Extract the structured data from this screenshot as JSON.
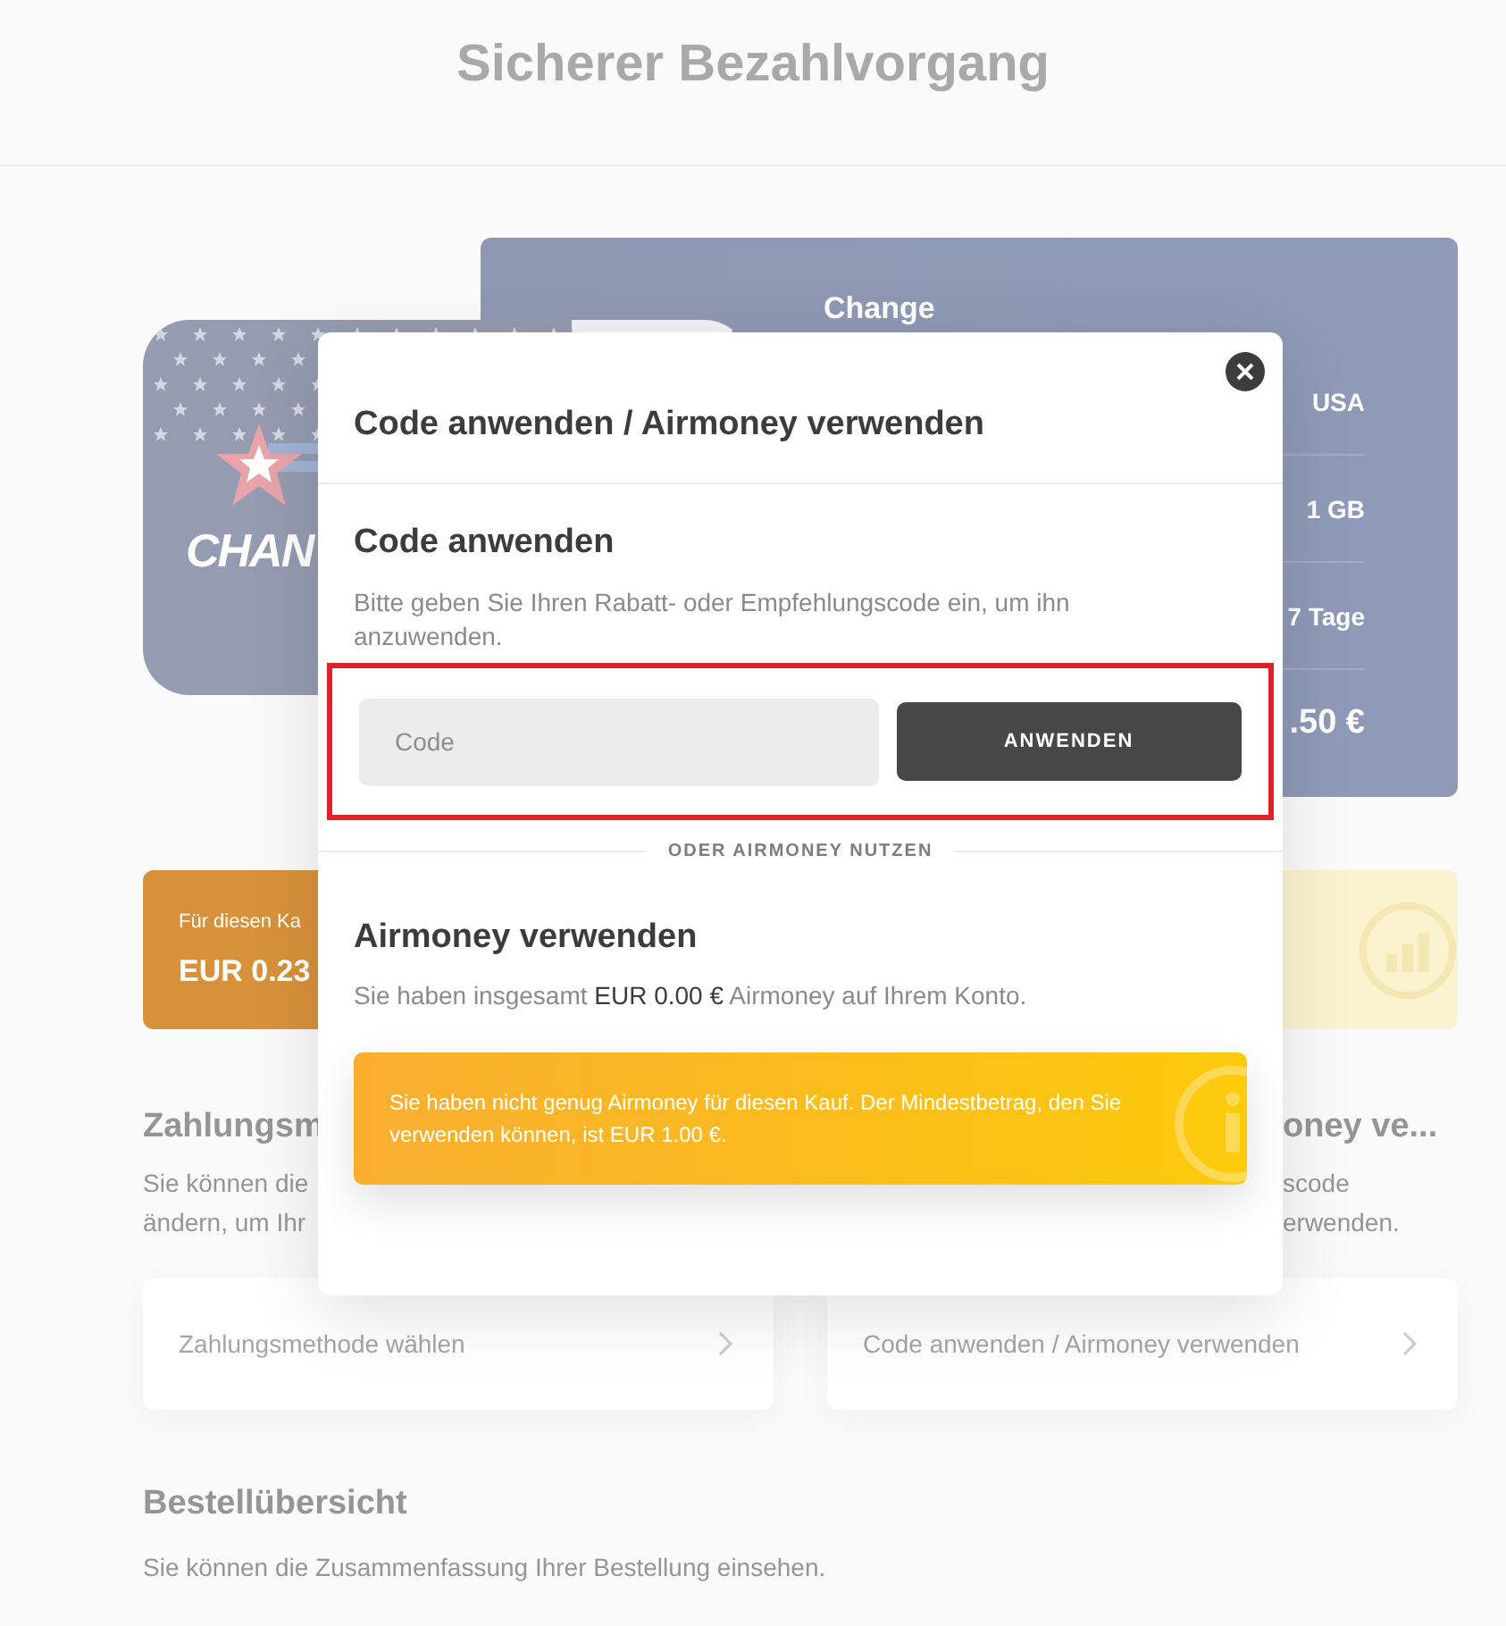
{
  "page": {
    "title": "Sicherer Bezahlvorgang"
  },
  "product": {
    "card_brand": "CHAN",
    "name": "Change",
    "details": [
      {
        "value": "USA"
      },
      {
        "value": "1 GB"
      },
      {
        "value": "7 Tage"
      }
    ],
    "price": ".50 €"
  },
  "cashback": {
    "label": "Für diesen Ka",
    "amount": "EUR 0.23"
  },
  "payment_section": {
    "title": "Zahlungsm",
    "lines": [
      "Sie können die",
      "ändern, um Ihr"
    ]
  },
  "code_section": {
    "title": "oney ve...",
    "lines": [
      "scode",
      "erwenden."
    ]
  },
  "links": [
    {
      "label": "Zahlungsmethode wählen"
    },
    {
      "label": "Code anwenden / Airmoney verwenden"
    }
  ],
  "order_summary": {
    "title": "Bestellübersicht",
    "text": "Sie können die Zusammenfassung Ihrer Bestellung einsehen."
  },
  "modal": {
    "title": "Code anwenden / Airmoney verwenden",
    "code": {
      "title": "Code anwenden",
      "description": "Bitte geben Sie Ihren Rabatt- oder Empfehlungscode ein, um ihn anzuwenden.",
      "placeholder": "Code",
      "button": "ANWENDEN",
      "highlighted": true
    },
    "divider": "ODER AIRMONEY NUTZEN",
    "airmoney": {
      "title": "Airmoney verwenden",
      "balance_text": "Sie haben insgesamt **EUR 0.00 €** Airmoney auf Ihrem Konto.",
      "warning": "Sie haben nicht genug Airmoney für diesen Kauf. Der Mindestbetrag, den Sie verwenden können, ist EUR 1.00 €."
    }
  }
}
